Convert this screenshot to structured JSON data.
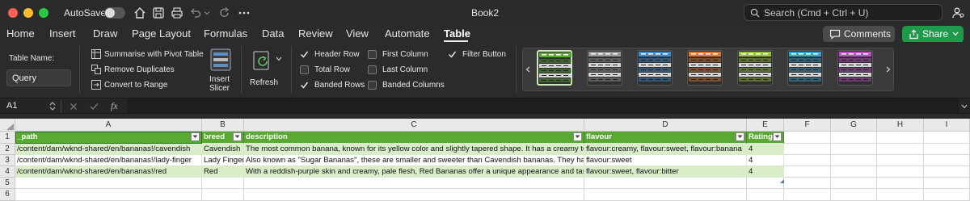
{
  "titlebar": {
    "autosave_label": "AutoSave",
    "book_title": "Book2",
    "search_placeholder": "Search (Cmd + Ctrl + U)"
  },
  "tabs": [
    {
      "label": "Home"
    },
    {
      "label": "Insert"
    },
    {
      "label": "Draw"
    },
    {
      "label": "Page Layout"
    },
    {
      "label": "Formulas"
    },
    {
      "label": "Data"
    },
    {
      "label": "Review"
    },
    {
      "label": "View"
    },
    {
      "label": "Automate"
    },
    {
      "label": "Table"
    }
  ],
  "actions": {
    "comments_label": "Comments",
    "share_label": "Share"
  },
  "ribbon": {
    "table_name_label": "Table Name:",
    "table_name_value": "Query",
    "tools": [
      "Summarise with Pivot Table",
      "Remove Duplicates",
      "Convert to Range"
    ],
    "insert_slicer": "Insert Slicer",
    "insert_slicer_l1": "Insert",
    "insert_slicer_l2": "Slicer",
    "refresh_label": "Refresh",
    "options": [
      {
        "label": "Header Row",
        "checked": true
      },
      {
        "label": "Total Row",
        "checked": false
      },
      {
        "label": "Banded Rows",
        "checked": true
      },
      {
        "label": "First Column",
        "checked": false
      },
      {
        "label": "Last Column",
        "checked": false
      },
      {
        "label": "Banded Columns",
        "checked": false
      },
      {
        "label": "Filter Button",
        "checked": true
      }
    ],
    "style_colors": [
      "#58a832",
      "#9a9a9a",
      "#3f8fd0",
      "#e07a34",
      "#9cc23b",
      "#3aa3d8",
      "#c24fc8"
    ]
  },
  "formula_bar": {
    "cell_ref": "A1",
    "fx": "fx",
    "value": ""
  },
  "sheet": {
    "columns": [
      "A",
      "B",
      "C",
      "D",
      "E",
      "F",
      "G",
      "H",
      "I"
    ],
    "row_numbers": [
      "1",
      "2",
      "3",
      "4",
      "5",
      "6"
    ],
    "headers": [
      "_path",
      "breed",
      "description",
      "flavour",
      "Rating"
    ],
    "rows": [
      [
        "/content/dam/wknd-shared/en/bananas!/cavendish",
        "Cavendish",
        "The most common banana, known for its yellow color and slightly tapered shape. It has a creamy textu",
        "flavour:creamy, flavour:sweet, flavour:banana",
        "4"
      ],
      [
        "/content/dam/wknd-shared/en/bananas!/lady-finger",
        "Lady Finger",
        "Also known as \"Sugar Bananas\", these are smaller and sweeter than Cavendish bananas. They have a c",
        "flavour:sweet",
        "4"
      ],
      [
        "/content/dam/wknd-shared/en/bananas!/red",
        "Red",
        "With a reddish-purple skin and creamy, pale flesh, Red Bananas offer a unique appearance and taste.",
        "flavour:sweet, flavour:bitter",
        "4"
      ]
    ]
  }
}
